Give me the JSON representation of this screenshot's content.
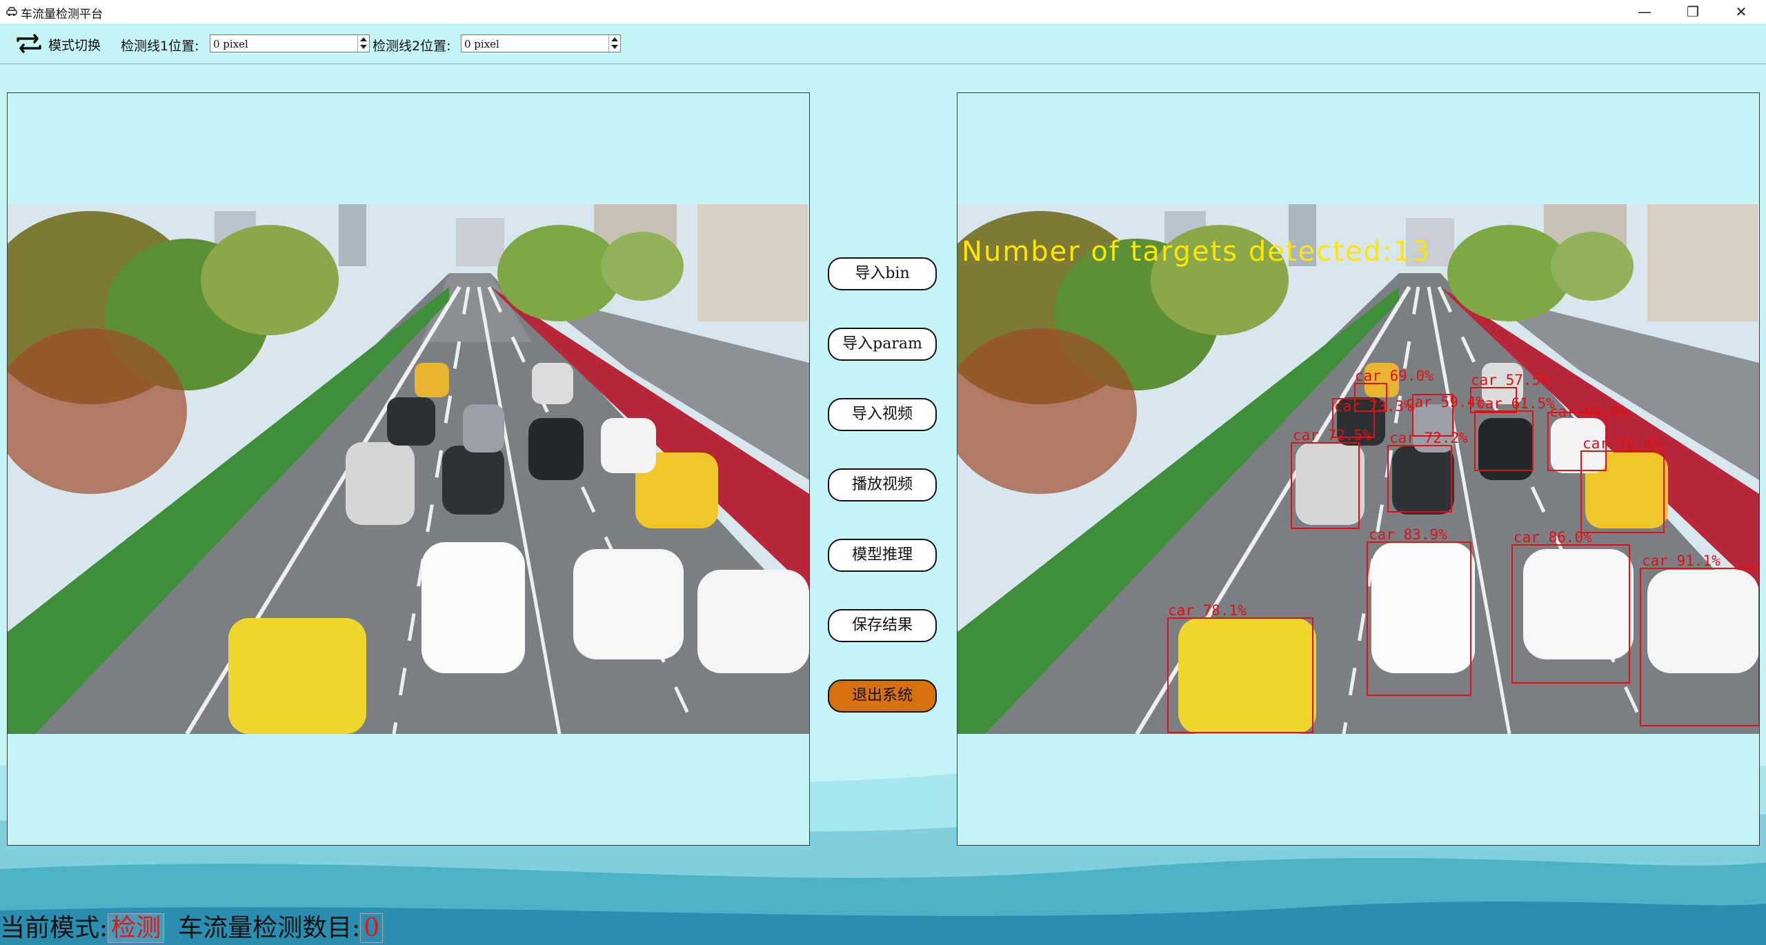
{
  "window": {
    "title": "车流量检测平台"
  },
  "toolbar": {
    "mode_switch_label": "模式切换",
    "line1_label": "检测线1位置:",
    "line1_value": "0 pixel",
    "line2_label": "检测线2位置:",
    "line2_value": "0 pixel"
  },
  "buttons": {
    "import_bin": "导入bin",
    "import_param": "导入param",
    "import_video": "导入视频",
    "play_video": "播放视频",
    "model_infer": "模型推理",
    "save_result": "保存结果",
    "exit": "退出系统"
  },
  "detection": {
    "overlay_text": "Number of targets detected:13",
    "labels": [
      "car 78.1%",
      "car 83.9%",
      "car 86.0%",
      "car 91.1%",
      "car 72.5%",
      "car 73.3%",
      "car 69.0%",
      "car 59.4%",
      "car 57.5%",
      "car 61.5%",
      "car 64.0%",
      "car 72.2%",
      "car 70.4%"
    ]
  },
  "status": {
    "mode_label": "当前模式:",
    "mode_value": "检测",
    "count_label": "车流量检测数目:",
    "count_value": "0"
  },
  "colors": {
    "background": "#c4f4f6",
    "exit_button": "#d7700f",
    "detection_box": "#e21010",
    "overlay_text": "#ffe600"
  }
}
